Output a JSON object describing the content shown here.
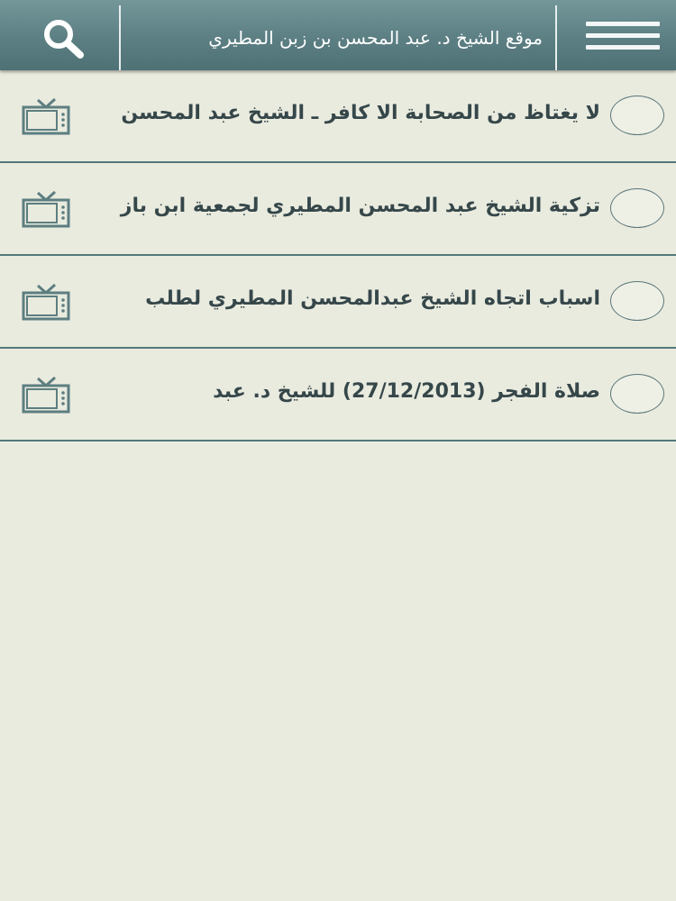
{
  "header": {
    "title": "موقع الشيخ د. عبد المحسن بن زبن المطيري",
    "search_icon": "search-icon",
    "menu_icon": "hamburger-menu-icon",
    "bar_color": "#5f8185"
  },
  "videos": [
    {
      "title": "لا يغتاظ من الصحابة الا كافر ـ الشيخ عبد المحسن",
      "icon": "tv-icon"
    },
    {
      "title": "تزكية الشيخ عبد المحسن المطيري لجمعية ابن باز",
      "icon": "tv-icon"
    },
    {
      "title": "اسباب اتجاه الشيخ عبدالمحسن المطيري لطلب",
      "icon": "tv-icon"
    },
    {
      "title": "صلاة الفجر (27/12/2013)  للشيخ د. عبد",
      "icon": "tv-icon"
    }
  ],
  "colors": {
    "background": "#e9ebdf",
    "separator": "#53787b",
    "icon": "#5d7e80",
    "text": "#36474a"
  }
}
